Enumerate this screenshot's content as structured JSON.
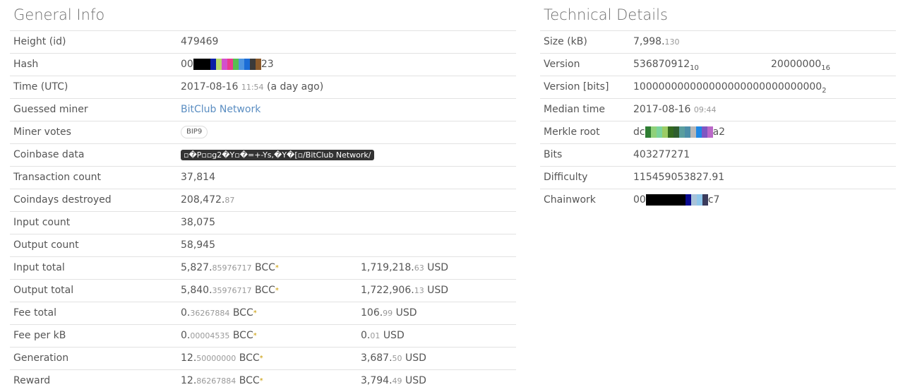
{
  "general": {
    "title": "General Info",
    "height_label": "Height (id)",
    "height_value": "479469",
    "hash_label": "Hash",
    "hash_prefix": "00",
    "hash_suffix": "23",
    "hash_mask_colors": [
      "#000000",
      "#000000",
      "#000000",
      "#0b1fa6",
      "#b8d96a",
      "#d34fcc",
      "#ea3a8f",
      "#56bd52",
      "#4e95e0",
      "#1b6dd6",
      "#3a3a3a",
      "#8b5a2b"
    ],
    "time_label": "Time (UTC)",
    "time_date": "2017-08-16",
    "time_clock": "11:54",
    "time_rel": "(a day ago)",
    "miner_label": "Guessed miner",
    "miner_value": "BitClub Network",
    "votes_label": "Miner votes",
    "votes_value": "BIP9",
    "coinbase_label": "Coinbase data",
    "coinbase_value": "▫�P▫▫g2�Y▫�=+-Ys,�Y�[▫/BitClub Network/",
    "txcount_label": "Transaction count",
    "txcount_value": "37,814",
    "coindays_label": "Coindays destroyed",
    "coindays_int": "208,472.",
    "coindays_dec": "87",
    "input_count_label": "Input count",
    "input_count_value": "38,075",
    "output_count_label": "Output count",
    "output_count_value": "58,945",
    "input_total_label": "Input total",
    "input_total_int": "5,827.",
    "input_total_dec": "85976717",
    "input_total_usd_int": "1,719,218.",
    "input_total_usd_dec": "63",
    "output_total_label": "Output total",
    "output_total_int": "5,840.",
    "output_total_dec": "35976717",
    "output_total_usd_int": "1,722,906.",
    "output_total_usd_dec": "13",
    "fee_total_label": "Fee total",
    "fee_total_int": "0.",
    "fee_total_dec": "36267884",
    "fee_total_usd_int": "106.",
    "fee_total_usd_dec": "99",
    "fee_kb_label": "Fee per kB",
    "fee_kb_int": "0.",
    "fee_kb_dec": "00004535",
    "fee_kb_usd_int": "0.",
    "fee_kb_usd_dec": "01",
    "generation_label": "Generation",
    "generation_int": "12.",
    "generation_dec": "50000000",
    "generation_usd_int": "3,687.",
    "generation_usd_dec": "50",
    "reward_label": "Reward",
    "reward_int": "12.",
    "reward_dec": "86267884",
    "reward_usd_int": "3,794.",
    "reward_usd_dec": "49",
    "unit": "BCC",
    "unit_star": "*",
    "usd": "USD"
  },
  "technical": {
    "title": "Technical Details",
    "size_label": "Size (kB)",
    "size_int": "7,998.",
    "size_dec": "130",
    "version_label": "Version",
    "version_dec": "536870912",
    "version_dec_base": "10",
    "version_hex": "20000000",
    "version_hex_base": "16",
    "version_bits_label": "Version [bits]",
    "version_bits_value": "100000000000000000000000000000",
    "version_bits_base": "2",
    "median_label": "Median time",
    "median_date": "2017-08-16",
    "median_clock": "09:44",
    "merkle_label": "Merkle root",
    "merkle_prefix": "dc",
    "merkle_suffix": "a2",
    "merkle_mask_colors": [
      "#2e7d32",
      "#8fd17a",
      "#7bd39b",
      "#9ccc65",
      "#33691e",
      "#2e5d2e",
      "#5a9e9e",
      "#4c8ea8",
      "#b7b7b7",
      "#1e88e5",
      "#7e57c2",
      "#ba68c8"
    ],
    "bits_label": "Bits",
    "bits_value": "403277271",
    "difficulty_label": "Difficulty",
    "difficulty_value": "115459053827.91",
    "chainwork_label": "Chainwork",
    "chainwork_prefix": "00",
    "chainwork_suffix": "c7",
    "chainwork_mask_colors": [
      "#000000",
      "#000000",
      "#000000",
      "#000000",
      "#000000",
      "#000000",
      "#000000",
      "#0a0a8f",
      "#a9c3d9",
      "#8fc7ea",
      "#3b3b5c"
    ]
  }
}
